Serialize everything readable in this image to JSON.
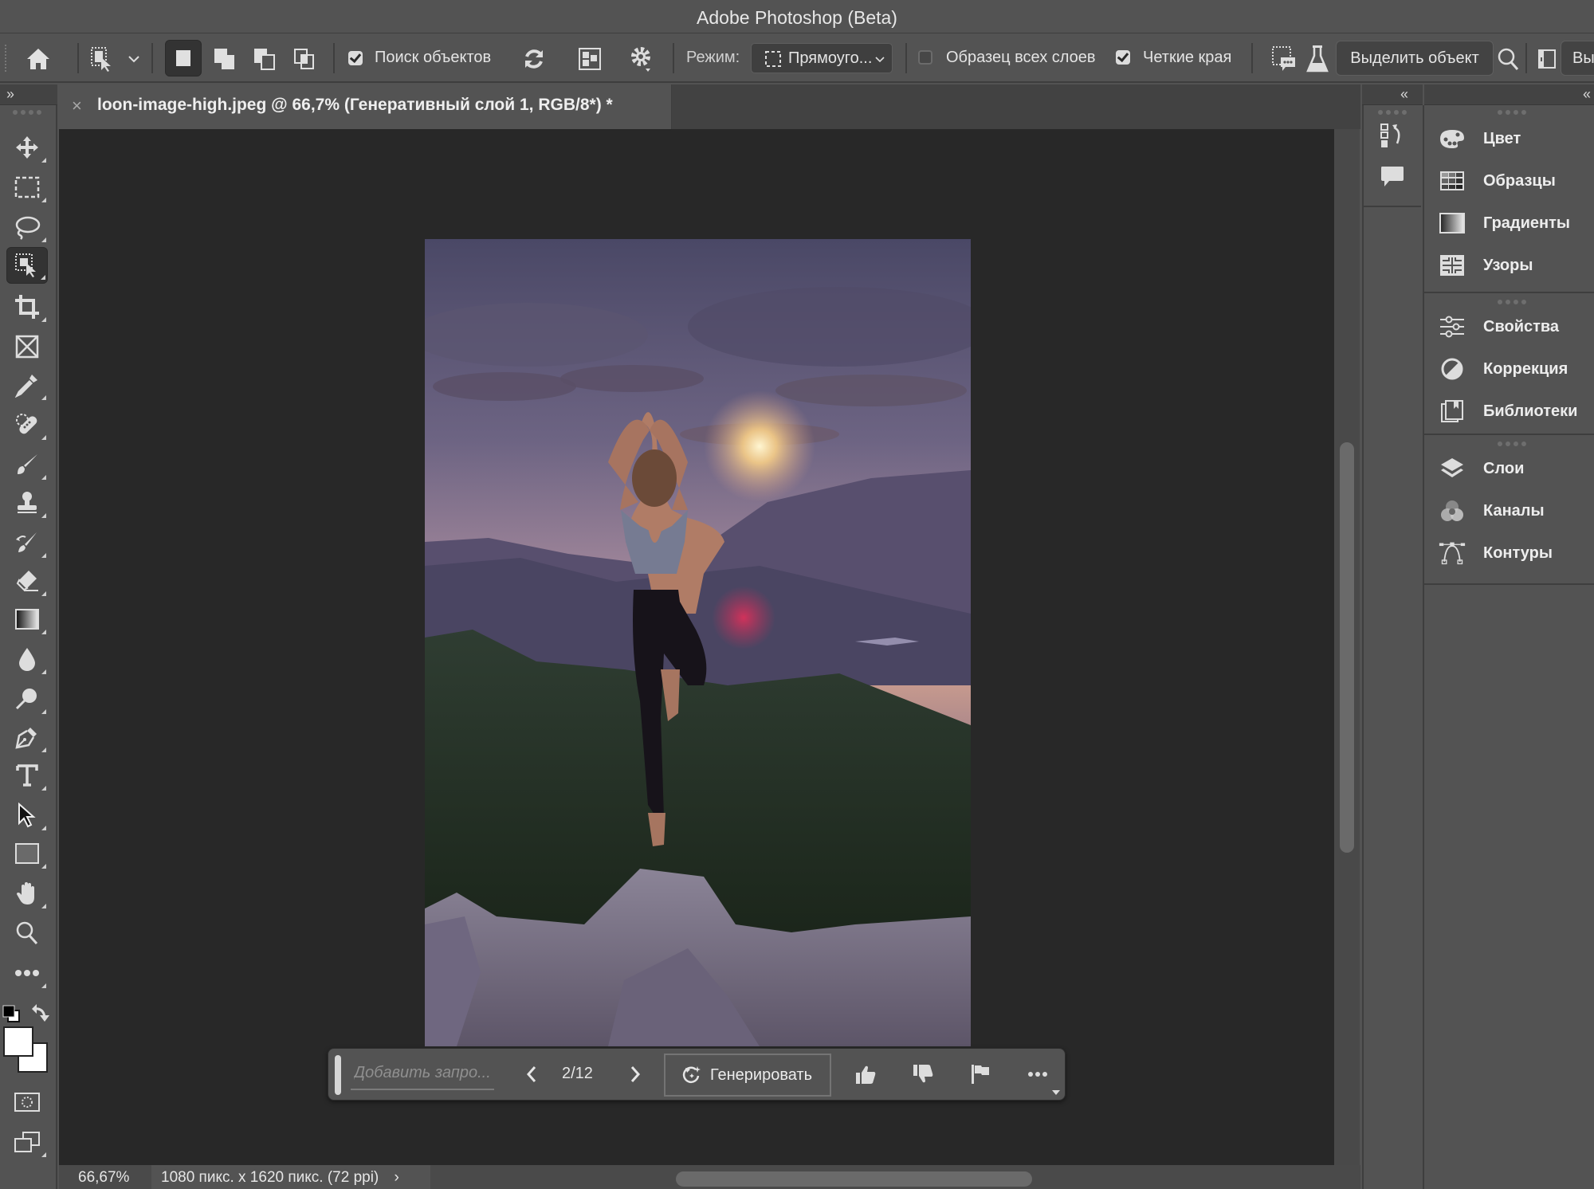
{
  "app": {
    "title": "Adobe Photoshop (Beta)"
  },
  "options_bar": {
    "find_objects_label": "Поиск объектов",
    "find_objects_checked": true,
    "mode_label": "Режим:",
    "mode_value": "Прямоуго...",
    "sample_all_layers_label": "Образец всех слоев",
    "sample_all_layers_checked": false,
    "hard_edges_label": "Четкие края",
    "hard_edges_checked": true,
    "select_subject_label": "Выделить объект",
    "select_mask_label_partial": "Вы"
  },
  "document": {
    "tab_title": "loon-image-high.jpeg @ 66,7% (Генеративный слой 1, RGB/8*) *",
    "close_glyph": "×"
  },
  "status_bar": {
    "zoom": "66,67%",
    "doc_info": "1080 пикс. x 1620 пикс. (72 ppi)",
    "arrow": "›"
  },
  "task_bar": {
    "prompt_placeholder": "Добавить запро...",
    "variation_current": 2,
    "variation_total": 12,
    "counter_text": "2/12",
    "generate_label": "Генерировать"
  },
  "tools": [
    "move-tool",
    "marquee-tool",
    "lasso-tool",
    "object-selection-tool",
    "crop-tool",
    "frame-tool",
    "eyedropper-tool",
    "healing-brush-tool",
    "brush-tool",
    "clone-stamp-tool",
    "history-brush-tool",
    "eraser-tool",
    "gradient-tool",
    "blur-tool",
    "dodge-tool",
    "pen-tool",
    "type-tool",
    "path-selection-tool",
    "rectangle-tool",
    "hand-tool",
    "zoom-tool",
    "more-tools"
  ],
  "active_tool": "object-selection-tool",
  "panels": {
    "group1": [
      {
        "label": "Цвет",
        "icon": "palette-icon"
      },
      {
        "label": "Образцы",
        "icon": "swatches-icon"
      },
      {
        "label": "Градиенты",
        "icon": "gradients-icon"
      },
      {
        "label": "Узоры",
        "icon": "patterns-icon"
      }
    ],
    "group2": [
      {
        "label": "Свойства",
        "icon": "properties-icon"
      },
      {
        "label": "Коррекция",
        "icon": "adjustments-icon"
      },
      {
        "label": "Библиотеки",
        "icon": "libraries-icon"
      }
    ],
    "group3": [
      {
        "label": "Слои",
        "icon": "layers-icon"
      },
      {
        "label": "Каналы",
        "icon": "channels-icon"
      },
      {
        "label": "Контуры",
        "icon": "paths-icon"
      }
    ]
  },
  "colors": {
    "ui_bg": "#535353",
    "canvas_bg": "#282828",
    "foreground": "#000000",
    "background": "#ffffff"
  }
}
